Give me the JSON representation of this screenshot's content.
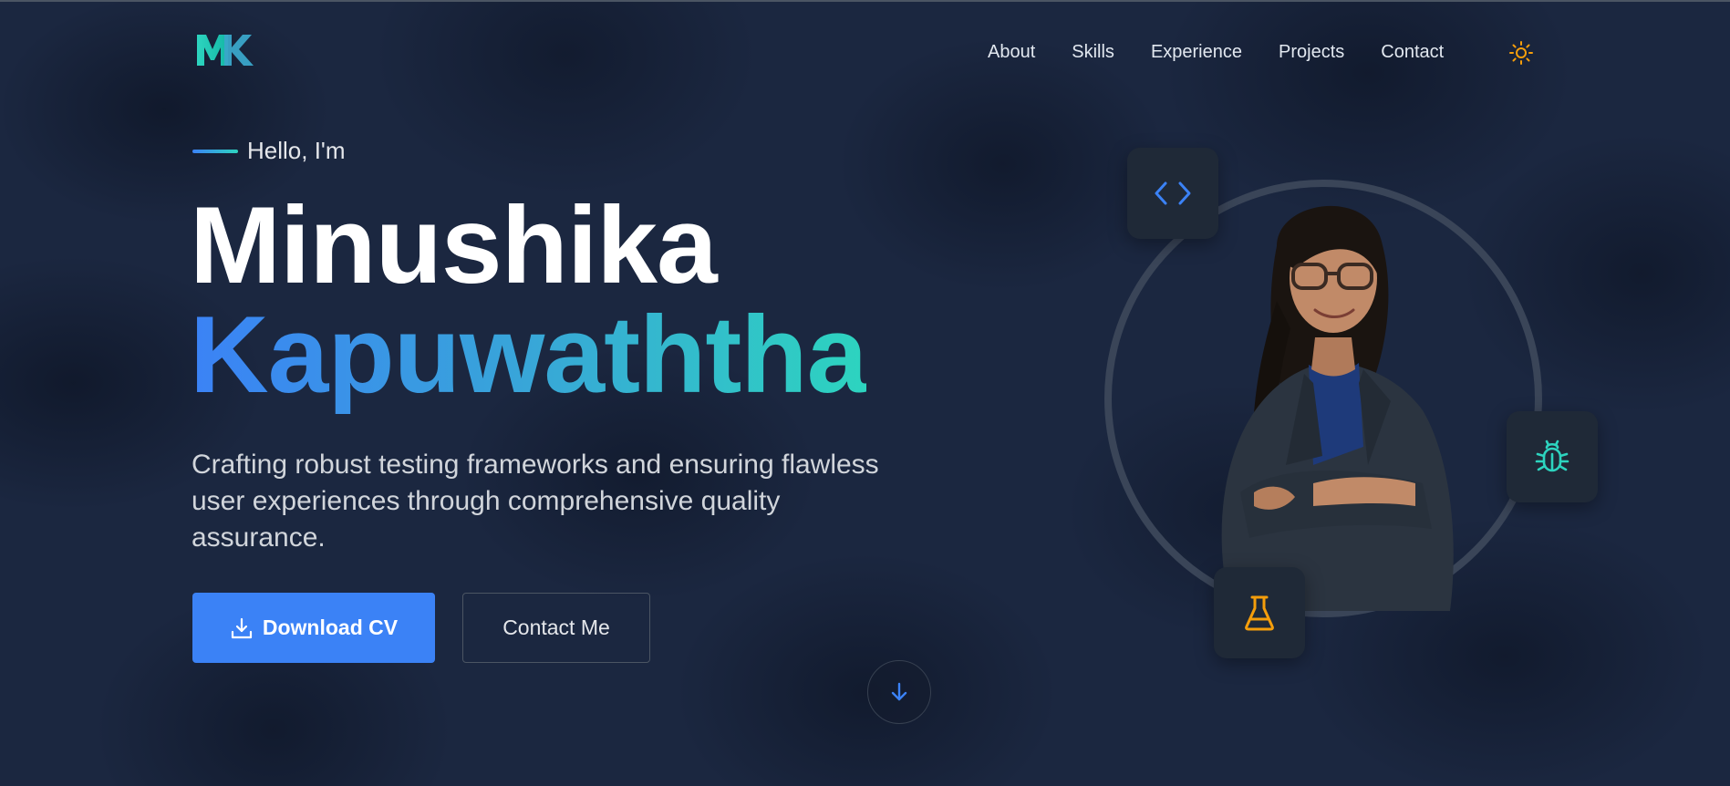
{
  "brand": {
    "logo_text": "MK",
    "colors": {
      "primary": "#3b82f6",
      "accent": "#2dd4bf",
      "warning": "#f59e0b"
    }
  },
  "nav": {
    "items": [
      {
        "label": "About"
      },
      {
        "label": "Skills"
      },
      {
        "label": "Experience"
      },
      {
        "label": "Projects"
      },
      {
        "label": "Contact"
      }
    ],
    "theme_toggle_icon": "sun-icon"
  },
  "hero": {
    "greeting": "Hello, I'm",
    "first_name": "Minushika",
    "last_name": "Kapuwaththa",
    "tagline": "Crafting robust testing frameworks and ensuring flawless user experiences through comprehensive quality assurance.",
    "download_cv_label": "Download CV",
    "download_icon": "download-icon",
    "contact_label": "Contact Me",
    "scroll_icon": "arrow-down-icon"
  },
  "profile": {
    "floating_icons": [
      "code-icon",
      "bug-icon",
      "flask-icon"
    ]
  }
}
